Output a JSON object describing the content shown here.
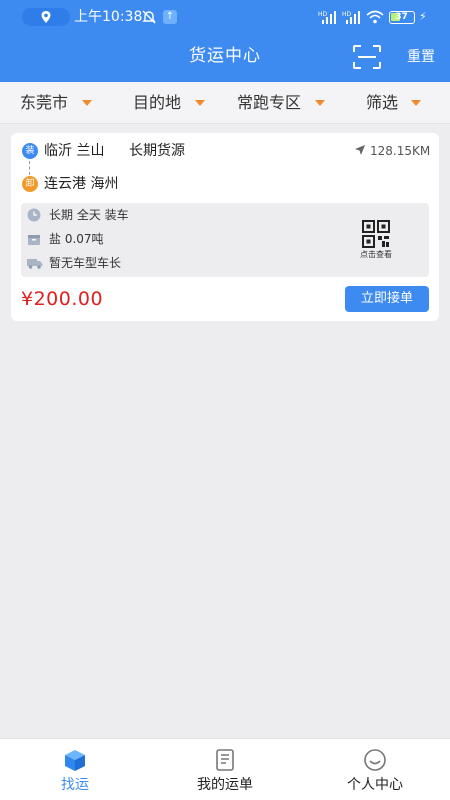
{
  "status_bar": {
    "time": "上午10:38",
    "battery": "37",
    "icons": [
      "location-icon",
      "bell-off-icon",
      "upload-icon",
      "signal-hd-icon",
      "signal-hd-icon",
      "wifi-icon",
      "battery-icon",
      "charging-icon"
    ]
  },
  "header": {
    "title": "货运中心",
    "reset_label": "重置",
    "scan_icon": "scan-icon"
  },
  "filters": [
    {
      "label": "东莞市"
    },
    {
      "label": "目的地"
    },
    {
      "label": "常跑专区"
    },
    {
      "label": "筛选"
    }
  ],
  "colors": {
    "primary": "#3d8bf0",
    "price": "#e02020",
    "load_tag": "#3d8bf0",
    "unload_tag": "#f19a2b",
    "caret": "#f08a2c"
  },
  "order": {
    "load_tag": "装",
    "unload_tag": "卸",
    "origin": "临沂 兰山",
    "cargo_type": "长期货源",
    "distance": "128.15KM",
    "destination": "连云港 海州",
    "schedule": "长期  全天 装车",
    "goods": "盐  0.07吨",
    "vehicle": "暂无车型车长",
    "qr_label": "点击查看",
    "price": "¥200.00",
    "accept_label": "立即接单"
  },
  "tabs": [
    {
      "label": "找运",
      "icon": "box-icon",
      "active": true
    },
    {
      "label": "我的运单",
      "icon": "document-icon",
      "active": false
    },
    {
      "label": "个人中心",
      "icon": "smile-icon",
      "active": false
    }
  ]
}
